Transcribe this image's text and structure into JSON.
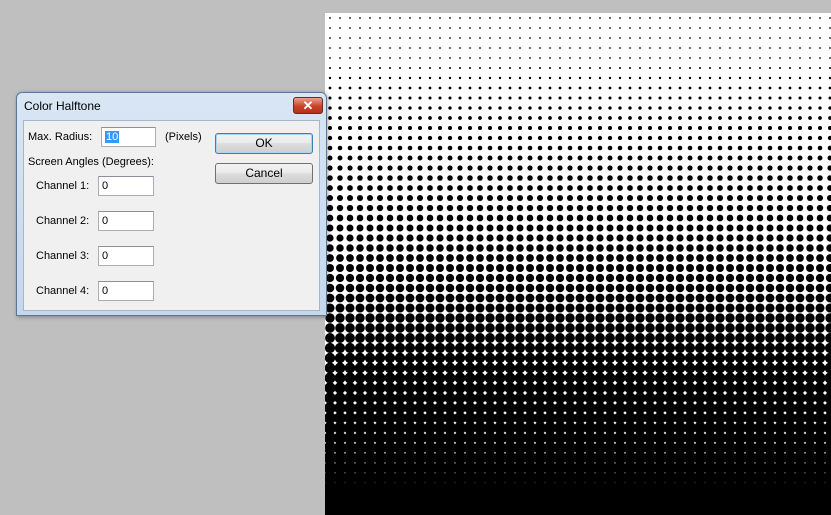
{
  "dialog": {
    "title": "Color Halftone",
    "close_label": "✕",
    "max_radius_label": "Max. Radius:",
    "max_radius_value": "10",
    "max_radius_unit": "(Pixels)",
    "screen_angles_label": "Screen Angles (Degrees):",
    "channels": [
      {
        "label": "Channel 1:",
        "value": "0"
      },
      {
        "label": "Channel 2:",
        "value": "0"
      },
      {
        "label": "Channel 3:",
        "value": "0"
      },
      {
        "label": "Channel 4:",
        "value": "0"
      }
    ],
    "ok_label": "OK",
    "cancel_label": "Cancel"
  },
  "colors": {
    "workspace_bg": "#bfbfbf",
    "canvas_bg": "#ffffff",
    "dot_color": "#000000"
  }
}
